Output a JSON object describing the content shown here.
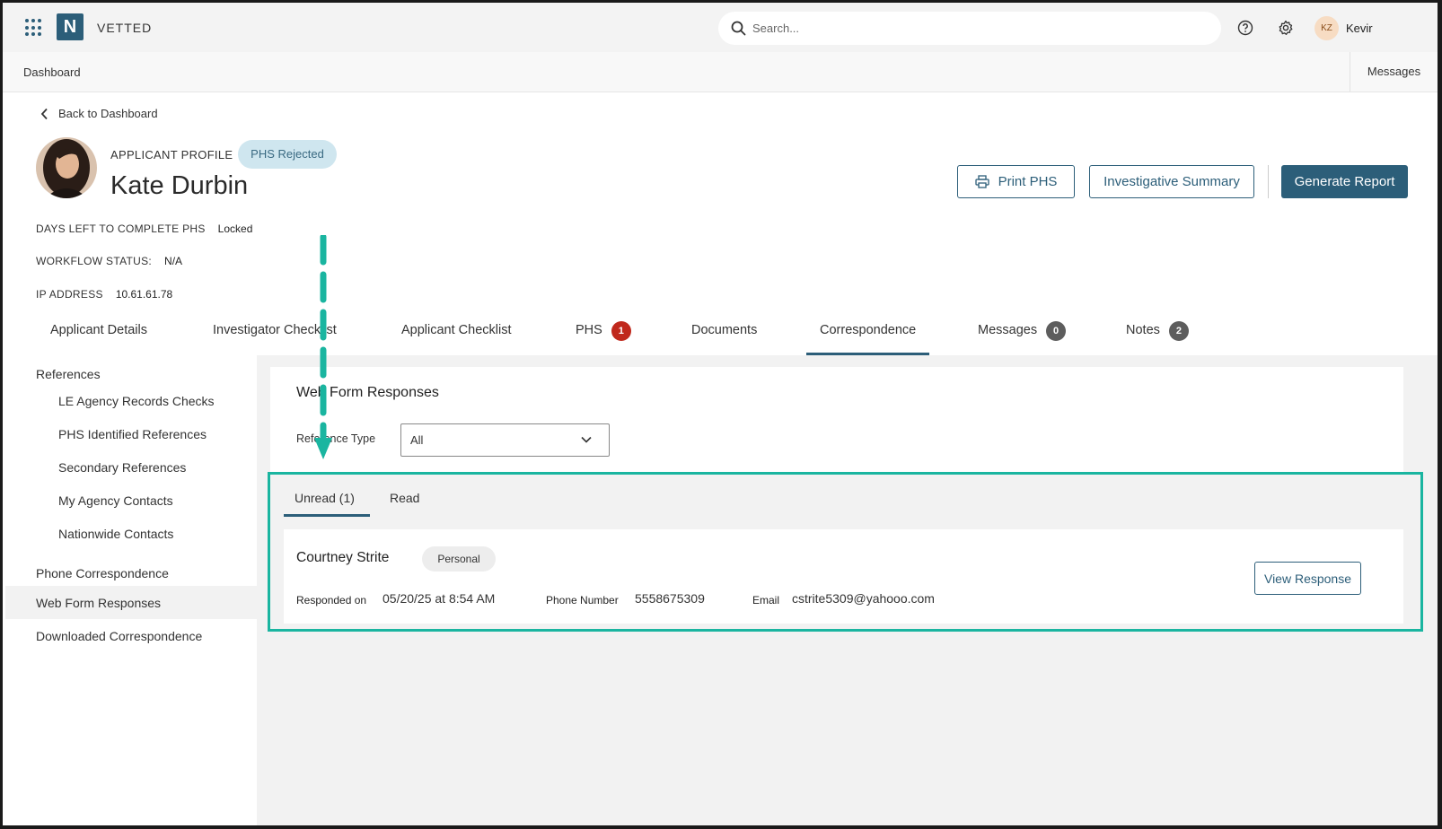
{
  "topbar": {
    "brand": "VETTED",
    "logo_letter": "N",
    "search_placeholder": "Search...",
    "user_initials": "KZ",
    "user_name": "Kevir"
  },
  "subbar": {
    "breadcrumb": "Dashboard",
    "messages": "Messages"
  },
  "header": {
    "back": "Back to Dashboard",
    "profile_label": "APPLICANT PROFILE",
    "status": "PHS Rejected",
    "name": "Kate Durbin",
    "buttons": {
      "print": "Print PHS",
      "summary": "Investigative Summary",
      "report": "Generate Report"
    },
    "meta": [
      {
        "label": "DAYS LEFT TO COMPLETE PHS",
        "value": "Locked"
      },
      {
        "label": "WORKFLOW STATUS:",
        "value": "N/A"
      },
      {
        "label": "IP ADDRESS",
        "value": "10.61.61.78"
      }
    ]
  },
  "tabs": [
    {
      "label": "Applicant Details"
    },
    {
      "label": "Investigator Checklist"
    },
    {
      "label": "Applicant Checklist"
    },
    {
      "label": "PHS",
      "count": "1"
    },
    {
      "label": "Documents"
    },
    {
      "label": "Correspondence"
    },
    {
      "label": "Messages",
      "count": "0"
    },
    {
      "label": "Notes",
      "count": "2"
    }
  ],
  "sidebar": {
    "references_heading": "References",
    "sub_items": [
      "LE Agency Records Checks",
      "PHS Identified References",
      "Secondary References",
      "My Agency Contacts",
      "Nationwide Contacts"
    ],
    "items": [
      "Phone Correspondence",
      "Web Form Responses",
      "Downloaded Correspondence"
    ]
  },
  "main": {
    "title": "Web Form Responses",
    "ref_type_label": "Reference Type",
    "ref_type_value": "All",
    "subtabs": [
      "Unread (1)",
      "Read"
    ],
    "response": {
      "name": "Courtney Strite",
      "type": "Personal",
      "responded_label": "Responded on",
      "responded_value": "05/20/25 at 8:54 AM",
      "phone_label": "Phone Number",
      "phone_value": "5558675309",
      "email_label": "Email",
      "email_value": "cstrite5309@yahooo.com",
      "view_button": "View Response"
    }
  },
  "colors": {
    "brand": "#2c5e79",
    "highlight": "#1ab5a0",
    "badge_red": "#c0281c"
  }
}
